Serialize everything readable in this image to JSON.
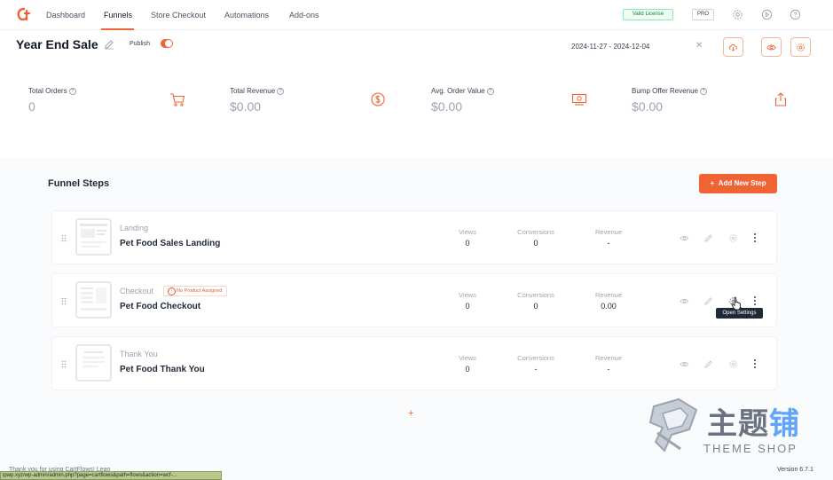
{
  "nav": {
    "items": [
      {
        "label": "Dashboard",
        "active": false
      },
      {
        "label": "Funnels",
        "active": true
      },
      {
        "label": "Store Checkout",
        "active": false
      },
      {
        "label": "Automations",
        "active": false
      },
      {
        "label": "Add-ons",
        "active": false
      }
    ],
    "license_badge": "Valid License",
    "pro_badge": "PRO",
    "icons": [
      "gear-icon",
      "play-icon",
      "help-icon"
    ],
    "accent_color": "#f06335"
  },
  "funnel": {
    "title": "Year End Sale",
    "publish_label": "Publish",
    "published": true,
    "date_range": "2024-11-27 - 2024-12-04",
    "clear_symbol": "✕"
  },
  "stats": [
    {
      "label": "Total Orders",
      "value": "0",
      "icon": "cart-icon"
    },
    {
      "label": "Total Revenue",
      "value": "$0.00",
      "icon": "dollar-icon"
    },
    {
      "label": "Avg. Order Value",
      "value": "$0.00",
      "icon": "money-icon"
    },
    {
      "label": "Bump Offer Revenue",
      "value": "$0.00",
      "icon": "share-icon"
    }
  ],
  "steps_section": {
    "title": "Funnel Steps",
    "add_button": "Add New Step",
    "add_symbol": "+"
  },
  "metric_labels": {
    "views": "Views",
    "conversions": "Conversions",
    "revenue": "Revenue"
  },
  "steps": [
    {
      "type": "Landing",
      "name": "Pet Food Sales Landing",
      "views": "0",
      "conversions": "0",
      "revenue": "-",
      "warning": ""
    },
    {
      "type": "Checkout",
      "name": "Pet Food Checkout",
      "views": "0",
      "conversions": "0",
      "revenue": "0.00",
      "warning": "No Product Assigned"
    },
    {
      "type": "Thank You",
      "name": "Pet Food Thank You",
      "views": "0",
      "conversions": "-",
      "revenue": "-",
      "warning": ""
    }
  ],
  "tooltip": "Open Settings",
  "add_plus": "+",
  "watermark": {
    "cn_1": "主题",
    "cn_2": "铺",
    "en": "THEME SHOP"
  },
  "version": "Version 6.7.1",
  "footer_thanks": "Thank you for using CartFlows! Lean",
  "status_url": "ipwp.xyz/wp-admin/admin.php?page=cartflows&path=flows&action=wcf-..."
}
